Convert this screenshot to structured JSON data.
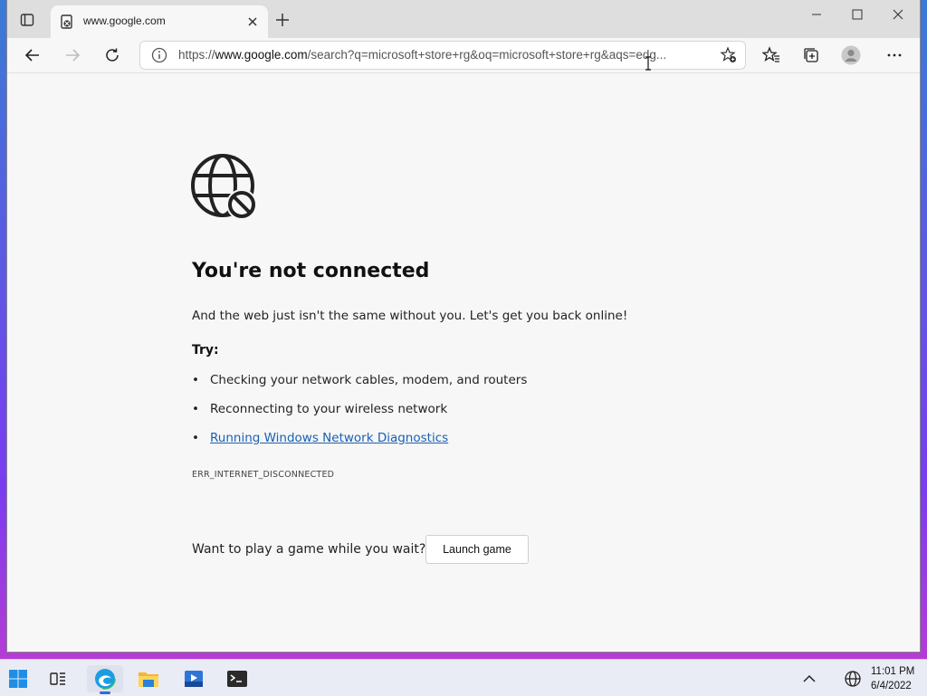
{
  "browser": {
    "tab": {
      "title": "www.google.com"
    },
    "address": {
      "scheme": "https://",
      "host": "www.google.com",
      "rest": "/search?q=microsoft+store+rg&oq=microsoft+store+rg&aqs=edg..."
    }
  },
  "error_page": {
    "heading": "You're not connected",
    "subtitle": "And the web just isn't the same without you. Let's get you back online!",
    "try_label": "Try:",
    "suggestions": [
      "Checking your network cables, modem, and routers",
      "Reconnecting to your wireless network",
      "Running Windows Network Diagnostics"
    ],
    "bullet": "•",
    "error_code": "ERR_INTERNET_DISCONNECTED",
    "game_prompt": "Want to play a game while you wait?",
    "launch_label": "Launch game"
  },
  "taskbar": {
    "time": "11:01 PM",
    "date": "6/4/2022"
  },
  "colors": {
    "link": "#1a5fb4",
    "accent": "#2b6cd8"
  }
}
